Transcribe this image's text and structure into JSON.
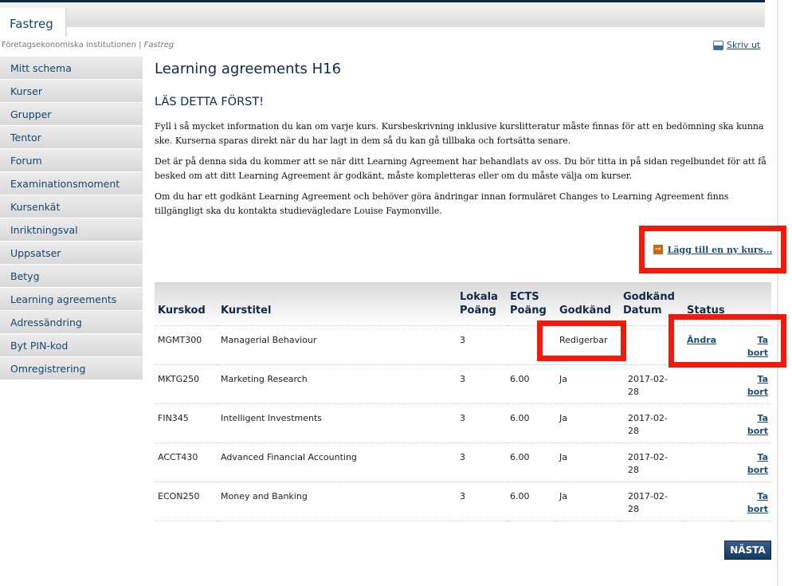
{
  "app": {
    "tab": "Fastreg"
  },
  "breadcrumb": {
    "org": "Företagsekonomiska institutionen",
    "sep": "|",
    "current": "Fastreg"
  },
  "print_label": "Skriv ut",
  "sidebar": {
    "items": [
      "Mitt schema",
      "Kurser",
      "Grupper",
      "Tentor",
      "Forum",
      "Examinationsmoment",
      "Kursenkät",
      "Inriktningsval",
      "Uppsatser",
      "Betyg",
      "Learning agreements",
      "Adressändring",
      "Byt PIN-kod",
      "Omregistrering"
    ]
  },
  "main": {
    "title": "Learning agreements H16",
    "subtitle": "LÄS DETTA FÖRST!",
    "paragraphs": [
      "Fyll i så mycket information du kan om varje kurs. Kursbeskrivning inklusive kurslitteratur måste finnas för att en bedömning ska kunna ske. Kurserna sparas direkt när du har lagt in dem så du kan gå tillbaka och fortsätta senare.",
      "Det är på denna sida du kommer att se när ditt Learning Agreement har behandlats av oss. Du bör titta in på sidan regelbundet för att få besked om att ditt Learning Agreement är godkänt, måste kompletteras eller om du måste välja om kurser.",
      "Om du har ett godkänt Learning Agreement och behöver göra ändringar innan formuläret Changes to Learning Agreement finns tillgängligt ska du kontakta studievägledare Louise Faymonville."
    ],
    "add_course": "Lägg till en ny kurs...",
    "next_button": "NÄSTA"
  },
  "table": {
    "headers": [
      "Kurskod",
      "Kurstitel",
      "Lokala Poäng",
      "ECTS Poäng",
      "Godkänd",
      "Godkänd Datum",
      "Status",
      ""
    ],
    "rows": [
      {
        "code": "MGMT300",
        "title": "Managerial Behaviour",
        "local": "3",
        "ects": "",
        "approved": "Redigerbar",
        "date": "",
        "edit": "Ändra",
        "remove": "Ta bort"
      },
      {
        "code": "MKTG250",
        "title": "Marketing Research",
        "local": "3",
        "ects": "6.00",
        "approved": "Ja",
        "date": "2017-02-28",
        "edit": "",
        "remove": "Ta bort"
      },
      {
        "code": "FIN345",
        "title": "Intelligent Investments",
        "local": "3",
        "ects": "6.00",
        "approved": "Ja",
        "date": "2017-02-28",
        "edit": "",
        "remove": "Ta bort"
      },
      {
        "code": "ACCT430",
        "title": "Advanced Financial Accounting",
        "local": "3",
        "ects": "6.00",
        "approved": "Ja",
        "date": "2017-02-28",
        "edit": "",
        "remove": "Ta bort"
      },
      {
        "code": "ECON250",
        "title": "Money and Banking",
        "local": "3",
        "ects": "6.00",
        "approved": "Ja",
        "date": "2017-02-28",
        "edit": "",
        "remove": "Ta bort"
      }
    ]
  },
  "colors": {
    "navy": "#0e2a4a",
    "link": "#1a4d7a",
    "highlight": "#f21a0a"
  }
}
